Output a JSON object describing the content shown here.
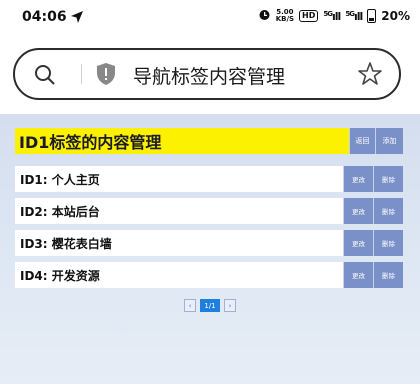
{
  "status_bar": {
    "time": "04:06",
    "speed_value": "5.00",
    "speed_unit": "KB/S",
    "hd_label": "HD",
    "signal1": "5G",
    "signal2": "5G",
    "battery": "20%"
  },
  "address_bar": {
    "text": "导航标签内容管理"
  },
  "panel": {
    "title": "ID1标签的内容管理",
    "back_label": "返回",
    "add_label": "添加"
  },
  "items": [
    {
      "label": "ID1: 个人主页",
      "edit": "更改",
      "delete": "删除"
    },
    {
      "label": "ID2: 本站后台",
      "edit": "更改",
      "delete": "删除"
    },
    {
      "label": "ID3: 樱花表白墙",
      "edit": "更改",
      "delete": "删除"
    },
    {
      "label": "ID4: 开发资源",
      "edit": "更改",
      "delete": "删除"
    }
  ],
  "pagination": {
    "prev": "‹",
    "current": "1/1",
    "next": "›"
  },
  "colors": {
    "title_bg": "#fbf100",
    "button_bg": "#7a90c8",
    "page_bg": "#d4deef",
    "pager_active": "#1f7fe0"
  }
}
